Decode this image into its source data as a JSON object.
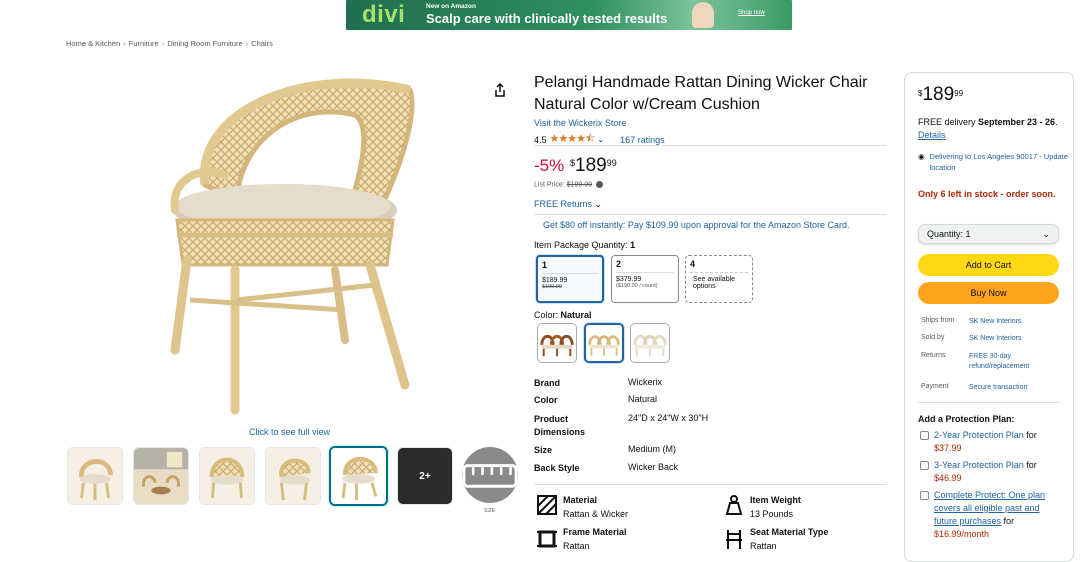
{
  "banner": {
    "logo": "divi",
    "kicker": "New on Amazon",
    "headline": "Scalp care with clinically tested results",
    "cta": "Shop now"
  },
  "breadcrumb": [
    "Home & Kitchen",
    "Furniture",
    "Dining Room Furniture",
    "Chairs"
  ],
  "gallery": {
    "click_full": "Click to see full view",
    "more_label": "2+",
    "size_label": "SIZE"
  },
  "product": {
    "title": "Pelangi Handmade Rattan Dining Wicker Chair Natural Color w/Cream Cushion",
    "store_link": "Visit the Wickerix Store",
    "rating_value": "4.5",
    "ratings_count": "167 ratings",
    "discount": "-5%",
    "price_currency": "$",
    "price_whole": "189",
    "price_fraction": "99",
    "list_price_label": "List Price:",
    "list_price": "$199.99",
    "free_returns": "FREE Returns",
    "promo": "Get $80 off instantly: Pay $109.99 upon approval for the Amazon Store Card.",
    "package_label": "Item Package Quantity:",
    "package_selected": "1",
    "packages": [
      {
        "qty": "1",
        "price": "$189.99",
        "sub": "$199.99"
      },
      {
        "qty": "2",
        "price": "$379.99",
        "sub": "($190.00 / count)"
      },
      {
        "qty": "4",
        "price": "See available",
        "sub": "options"
      }
    ],
    "color_label": "Color:",
    "color_selected": "Natural"
  },
  "specs": [
    {
      "key": "Brand",
      "value": "Wickerix"
    },
    {
      "key": "Color",
      "value": "Natural"
    },
    {
      "key": "Product Dimensions",
      "value": "24\"D x 24\"W x 30\"H"
    },
    {
      "key": "Size",
      "value": "Medium (M)"
    },
    {
      "key": "Back Style",
      "value": "Wicker Back"
    }
  ],
  "features": [
    {
      "title": "Material",
      "value": "Rattan & Wicker",
      "icon": "material-icon"
    },
    {
      "title": "Item Weight",
      "value": "13 Pounds",
      "icon": "weight-icon"
    },
    {
      "title": "Frame Material",
      "value": "Rattan",
      "icon": "frame-icon"
    },
    {
      "title": "Seat Material Type",
      "value": "Rattan",
      "icon": "seat-icon"
    }
  ],
  "buybox": {
    "price_currency": "$",
    "price_whole": "189",
    "price_fraction": "99",
    "delivery_prefix": "FREE delivery ",
    "delivery_dates": "September 23 - 26",
    "delivery_suffix": ".",
    "details_link": "Details",
    "location": "Delivering to Los Angeles 90017 - Update location",
    "stock": "Only 6 left in stock - order soon.",
    "quantity": "Quantity: 1",
    "add_to_cart": "Add to Cart",
    "buy_now": "Buy Now",
    "info": [
      {
        "key": "Ships from",
        "value": "SK New Interiors"
      },
      {
        "key": "Sold by",
        "value": "SK New Interiors"
      },
      {
        "key": "Returns",
        "value": "FREE 30-day refund/replacement"
      },
      {
        "key": "Payment",
        "value": "Secure transaction"
      }
    ],
    "protection_title": "Add a Protection Plan:",
    "protection": [
      {
        "label": "2-Year Protection Plan",
        "suffix": " for",
        "price": "$37.99"
      },
      {
        "label": "3-Year Protection Plan",
        "suffix": " for",
        "price": "$46.99"
      },
      {
        "label": "Complete Protect: One plan covers all eligible past and future purchases",
        "suffix": " for",
        "price": "$16.99/month"
      }
    ]
  },
  "colors": {
    "accent_link": "#2162a1",
    "discount_red": "#cc0c39",
    "stock_red": "#b12704",
    "cart_yellow": "#ffd814",
    "buy_orange": "#ffa41c",
    "star_orange": "#de7921"
  }
}
